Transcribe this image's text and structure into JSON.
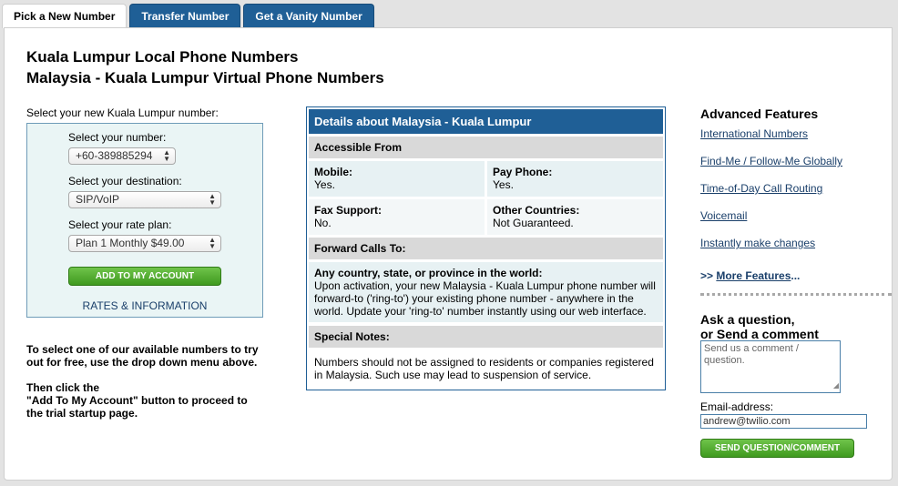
{
  "tabs": [
    {
      "label": "Pick a New Number",
      "active": true
    },
    {
      "label": "Transfer Number",
      "active": false
    },
    {
      "label": "Get a Vanity Number",
      "active": false
    }
  ],
  "titles": {
    "line1": "Kuala Lumpur Local Phone Numbers",
    "line2": "Malaysia - Kuala Lumpur Virtual Phone Numbers"
  },
  "picker": {
    "intro": "Select your new Kuala Lumpur number:",
    "number_label": "Select your number:",
    "number_value": "+60-389885294",
    "destination_label": "Select your destination:",
    "destination_value": "SIP/VoIP",
    "plan_label": "Select your rate plan:",
    "plan_value": "Plan 1 Monthly $49.00",
    "add_button": "ADD TO MY ACCOUNT",
    "rates_link": "RATES & INFORMATION"
  },
  "instructions": {
    "p1_line1": "To select one of our available numbers to try",
    "p1_line2": "out for free, use the drop down menu above.",
    "p2_line1": "Then click the",
    "p2_line2": "\"Add To My Account\" button to proceed to",
    "p2_line3": "the trial startup page."
  },
  "details": {
    "header": "Details about Malaysia - Kuala Lumpur",
    "accessible_from": "Accessible From",
    "mobile_label": "Mobile:",
    "mobile_value": "Yes.",
    "payphone_label": "Pay Phone:",
    "payphone_value": "Yes.",
    "fax_label": "Fax Support:",
    "fax_value": "No.",
    "other_label": "Other Countries:",
    "other_value": "Not Guaranteed.",
    "forward_title": "Forward Calls To:",
    "forward_head": "Any country, state, or province in the world:",
    "forward_l1": "Upon activation, your new Malaysia - Kuala Lumpur phone number will",
    "forward_l2": "forward-to ('ring-to') your existing phone number - anywhere in the",
    "forward_l3": "world. Update your 'ring-to' number instantly using our web interface.",
    "notes_title": "Special Notes:",
    "notes_l1": "Numbers should not be assigned to residents or companies registered",
    "notes_l2": "in Malaysia. Such use may lead to suspension of service."
  },
  "advanced": {
    "title": "Advanced Features",
    "features": [
      "International Numbers",
      "Find-Me / Follow-Me Globally",
      "Time-of-Day Call Routing",
      "Voicemail",
      "Instantly make changes"
    ],
    "more_prefix": ">>",
    "more_link": "More Features",
    "more_suffix": "..."
  },
  "ask": {
    "title_l1": "Ask a question,",
    "title_l2": "or Send a comment",
    "comment_placeholder": "Send us a comment / question.",
    "email_label": "Email-address:",
    "email_value": "andrew@twilio.com",
    "send_button": "SEND QUESTION/COMMENT"
  },
  "colors": {
    "tab_blue": "#1f5f96",
    "green_button": "#4caa28",
    "link": "#1a3f6a"
  }
}
